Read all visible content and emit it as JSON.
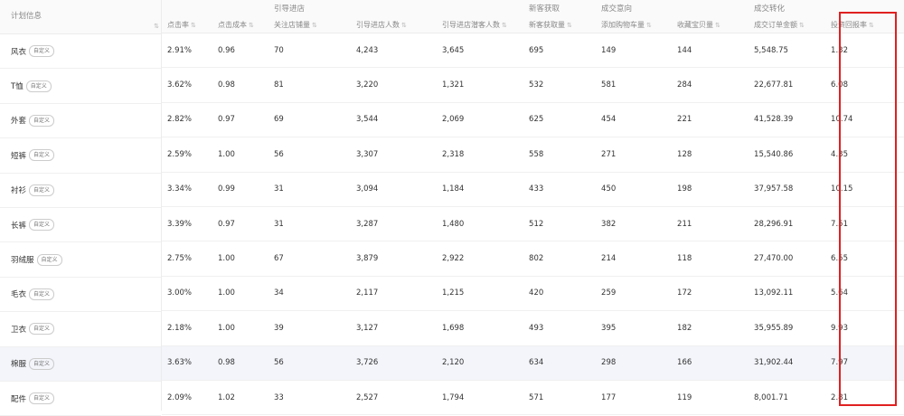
{
  "left": {
    "header": "计划信息",
    "tag": "自定义"
  },
  "groups": [
    "引导进店",
    "新客获取",
    "成交意向",
    "成交转化"
  ],
  "columns": [
    "点击率",
    "点击成本",
    "关注店铺量",
    "引导进店人数",
    "引导进店潜客人数",
    "新客获取量",
    "添加购物车量",
    "收藏宝贝量",
    "成交订单金额",
    "投资回报率"
  ],
  "rows": [
    {
      "name": "风衣",
      "cells": [
        "2.91%",
        "0.96",
        "70",
        "4,243",
        "3,645",
        "695",
        "149",
        "144",
        "5,548.75",
        "1.32"
      ]
    },
    {
      "name": "T恤",
      "cells": [
        "3.62%",
        "0.98",
        "81",
        "3,220",
        "1,321",
        "532",
        "581",
        "284",
        "22,677.81",
        "6.08"
      ]
    },
    {
      "name": "外套",
      "cells": [
        "2.82%",
        "0.97",
        "69",
        "3,544",
        "2,069",
        "625",
        "454",
        "221",
        "41,528.39",
        "10.74"
      ]
    },
    {
      "name": "短裤",
      "cells": [
        "2.59%",
        "1.00",
        "56",
        "3,307",
        "2,318",
        "558",
        "271",
        "128",
        "15,540.86",
        "4.35"
      ]
    },
    {
      "name": "衬衫",
      "cells": [
        "3.34%",
        "0.99",
        "31",
        "3,094",
        "1,184",
        "433",
        "450",
        "198",
        "37,957.58",
        "10.15"
      ]
    },
    {
      "name": "长裤",
      "cells": [
        "3.39%",
        "0.97",
        "31",
        "3,287",
        "1,480",
        "512",
        "382",
        "211",
        "28,296.91",
        "7.51"
      ]
    },
    {
      "name": "羽绒服",
      "cells": [
        "2.75%",
        "1.00",
        "67",
        "3,879",
        "2,922",
        "802",
        "214",
        "118",
        "27,470.00",
        "6.55"
      ]
    },
    {
      "name": "毛衣",
      "cells": [
        "3.00%",
        "1.00",
        "34",
        "2,117",
        "1,215",
        "420",
        "259",
        "172",
        "13,092.11",
        "5.64"
      ]
    },
    {
      "name": "卫衣",
      "cells": [
        "2.18%",
        "1.00",
        "39",
        "3,127",
        "1,698",
        "493",
        "395",
        "182",
        "35,955.89",
        "9.93"
      ]
    },
    {
      "name": "棉服",
      "cells": [
        "3.63%",
        "0.98",
        "56",
        "3,726",
        "2,120",
        "634",
        "298",
        "166",
        "31,902.44",
        "7.97"
      ]
    },
    {
      "name": "配件",
      "cells": [
        "2.09%",
        "1.02",
        "33",
        "2,527",
        "1,794",
        "571",
        "177",
        "119",
        "8,001.71",
        "2.81"
      ]
    }
  ],
  "sort_glyph": "⇅",
  "colors": {
    "highlight_frame": "#e02020",
    "hovered_row": "#f3f5fa"
  }
}
